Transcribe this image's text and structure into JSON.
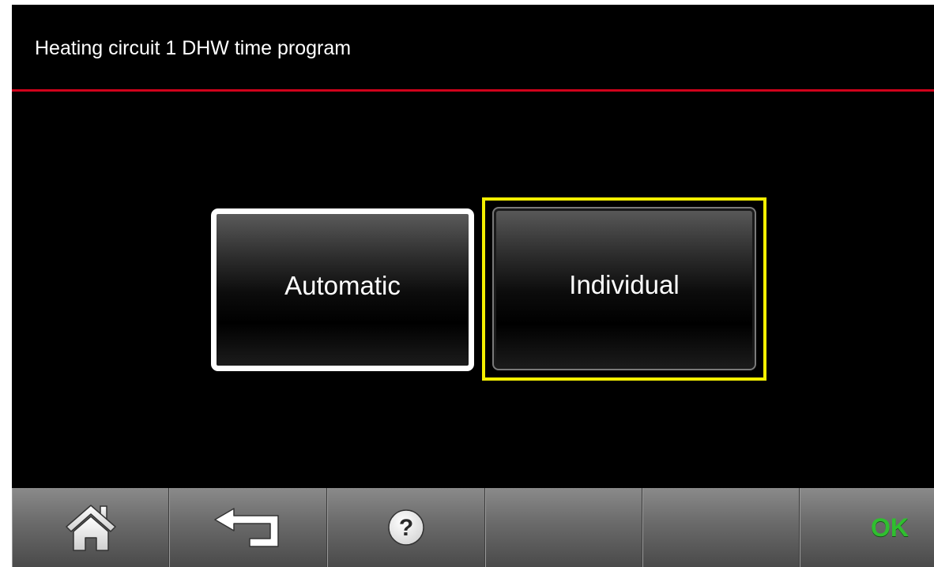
{
  "header": {
    "title": "Heating circuit 1 DHW time program"
  },
  "options": {
    "automatic_label": "Automatic",
    "individual_label": "Individual"
  },
  "footer": {
    "home_icon": "home-icon",
    "back_icon": "back-arrow-icon",
    "help_icon": "help-icon",
    "ok_label": "OK"
  },
  "colors": {
    "header_line": "#d0021b",
    "focus_frame": "#f4ef00",
    "ok_text": "#2fbf2f",
    "background": "#000000"
  }
}
